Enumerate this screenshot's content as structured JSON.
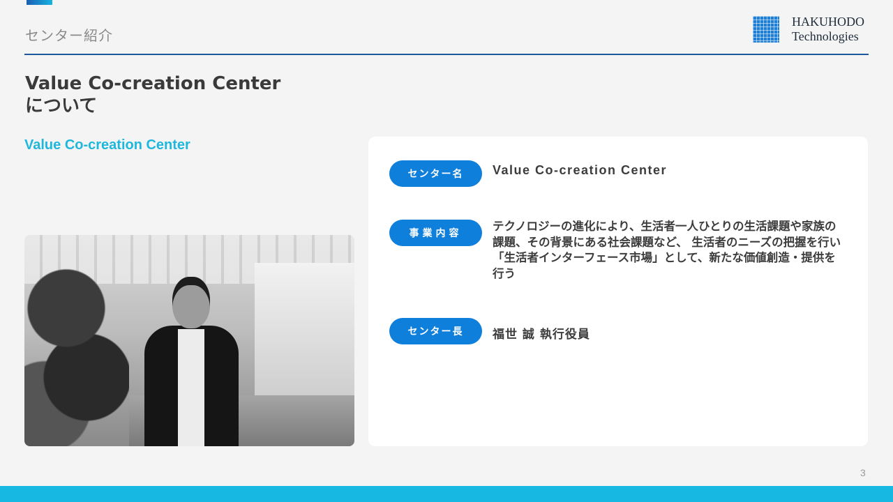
{
  "header": {
    "section_label": "センター紹介",
    "logo_line1": "HAKUHODO",
    "logo_line2": "Technologies"
  },
  "title": {
    "line1": "Value Co-creation Center",
    "line2": "について"
  },
  "subtitle": "Value Co-creation Center",
  "info": [
    {
      "label": "センター名",
      "value": "Value Co-creation Center"
    },
    {
      "label": "事業内容",
      "value": "テクノロジーの進化により、生活者一人ひとりの生活課題や家族の課題、その背景にある社会課題など、 生活者のニーズの把握を行い「生活者インターフェース市場」として、新たな価値創造・提供を行う"
    },
    {
      "label": "センター長",
      "value": "福世 誠  執行役員"
    }
  ],
  "page_number": "3",
  "colors": {
    "accent_blue": "#0f7fdc",
    "accent_cyan": "#17b9e2",
    "rule": "#1a5a9a"
  }
}
